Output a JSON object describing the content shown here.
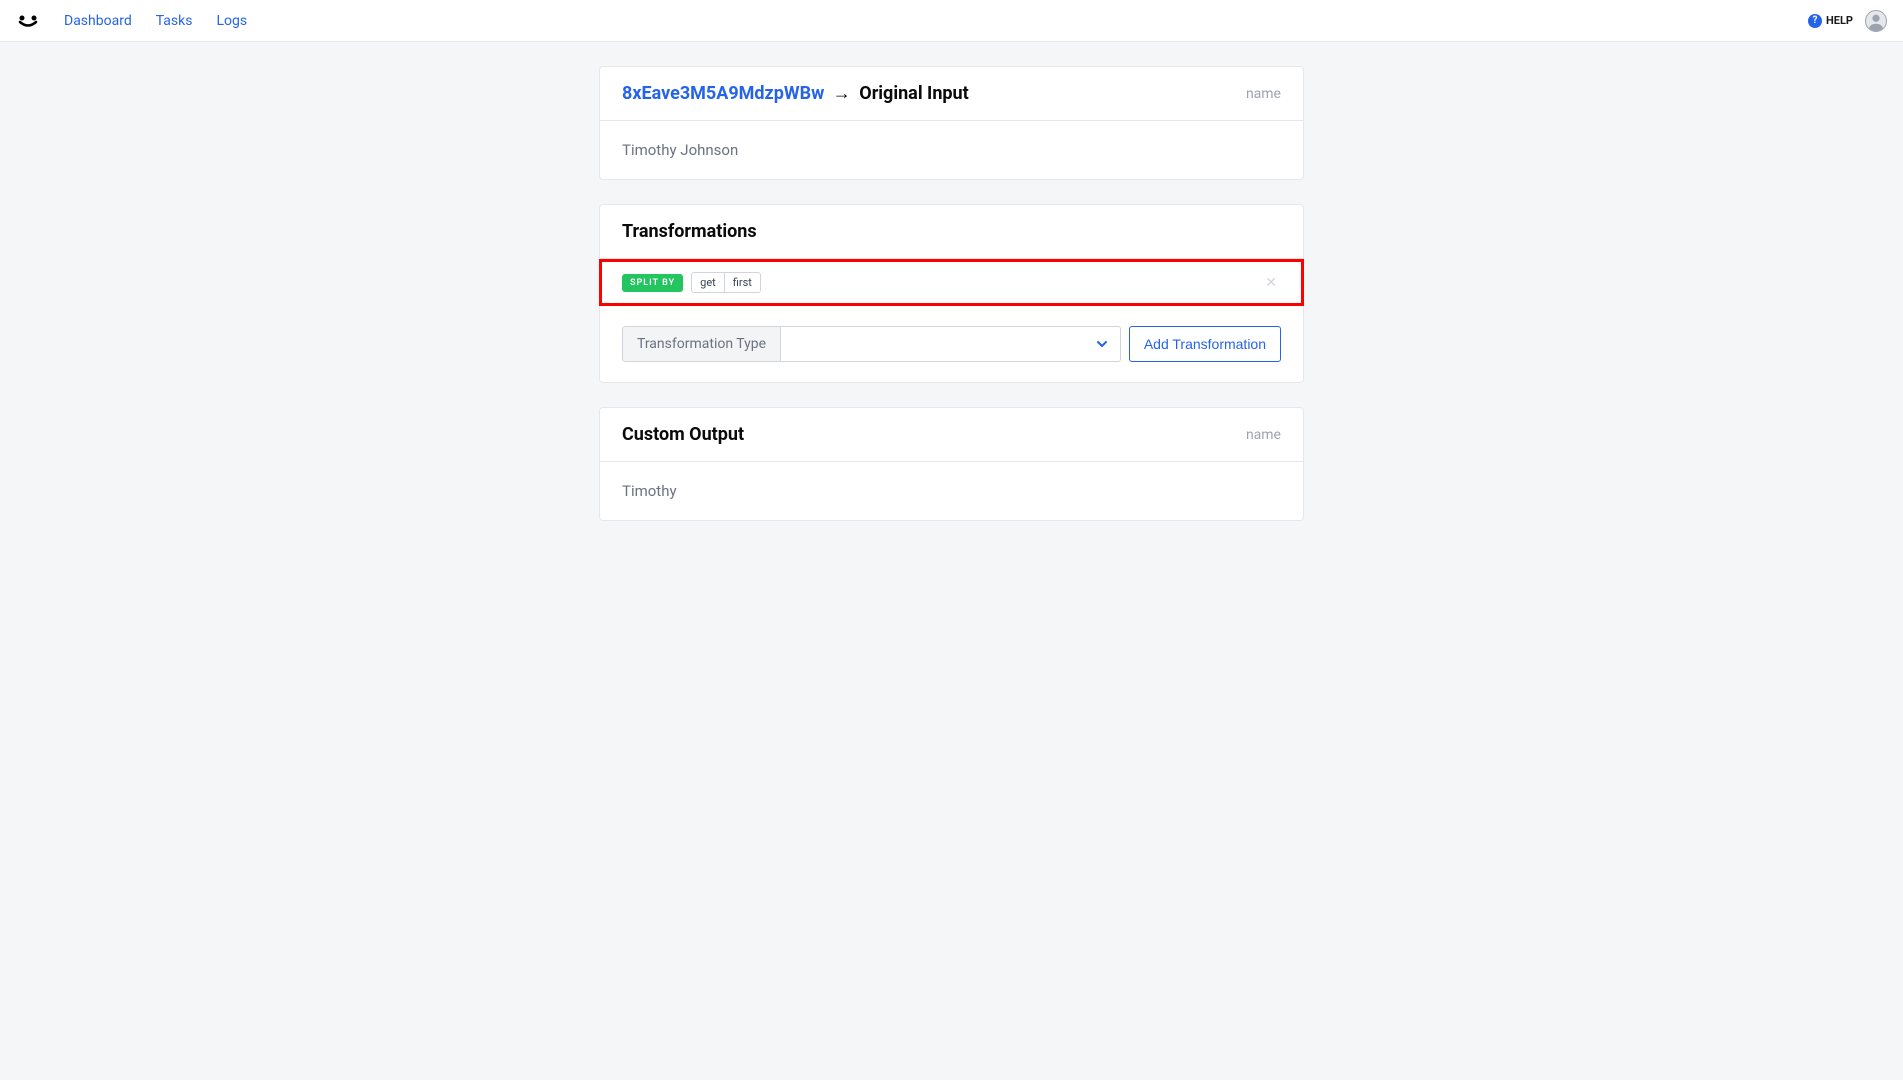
{
  "nav": {
    "dashboard": "Dashboard",
    "tasks": "Tasks",
    "logs": "Logs"
  },
  "header": {
    "help_label": "HELP"
  },
  "input_card": {
    "breadcrumb_id": "8xEave3M5A9MdzpWBw",
    "breadcrumb_arrow": "→",
    "breadcrumb_tail": "Original Input",
    "meta": "name",
    "value": "Timothy Johnson"
  },
  "transformations": {
    "title": "Transformations",
    "row": {
      "badge": "SPLIT BY",
      "pill1": "get",
      "pill2": "first"
    },
    "select_label": "Transformation Type",
    "add_button": "Add Transformation"
  },
  "output_card": {
    "title": "Custom Output",
    "meta": "name",
    "value": "Timothy"
  }
}
